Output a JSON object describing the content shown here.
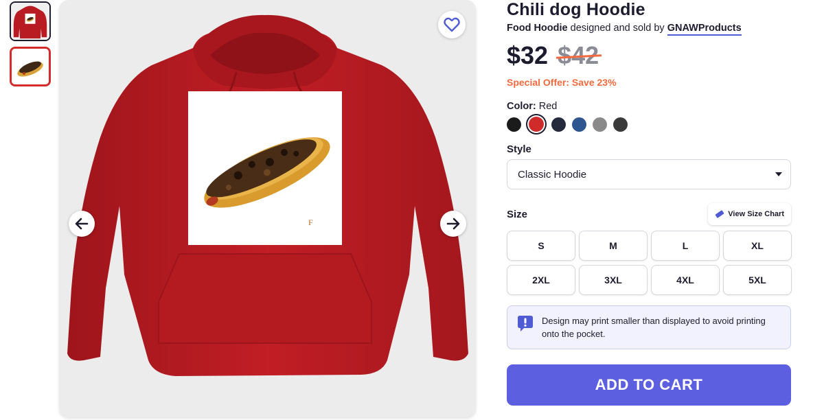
{
  "product": {
    "title": "Chili dog Hoodie",
    "category": "Food Hoodie",
    "byline_mid": "designed and sold by",
    "seller": "GNAWProducts"
  },
  "pricing": {
    "current": "$32",
    "original": "$42",
    "offer": "Special Offer: Save 23%"
  },
  "color": {
    "label": "Color:",
    "selected": "Red",
    "swatches": [
      {
        "name": "Black",
        "hex": "#1b1b1b"
      },
      {
        "name": "Red",
        "hex": "#cf2b2b"
      },
      {
        "name": "Navy",
        "hex": "#252b3d"
      },
      {
        "name": "Royal Blue",
        "hex": "#2f5590"
      },
      {
        "name": "Heather Gray",
        "hex": "#8a8a8a"
      },
      {
        "name": "Charcoal",
        "hex": "#3a3a3a"
      }
    ]
  },
  "style": {
    "label": "Style",
    "selected": "Classic Hoodie"
  },
  "size": {
    "label": "Size",
    "chart_button": "View Size Chart",
    "options": [
      "S",
      "M",
      "L",
      "XL",
      "2XL",
      "3XL",
      "4XL",
      "5XL"
    ]
  },
  "notice": {
    "text": "Design may print smaller than displayed to avoid printing onto the pocket."
  },
  "cart": {
    "button": "ADD TO CART"
  },
  "colors": {
    "accent": "#5b5fe0",
    "offer": "#f26a3d",
    "hoodie": "#b81c22"
  }
}
